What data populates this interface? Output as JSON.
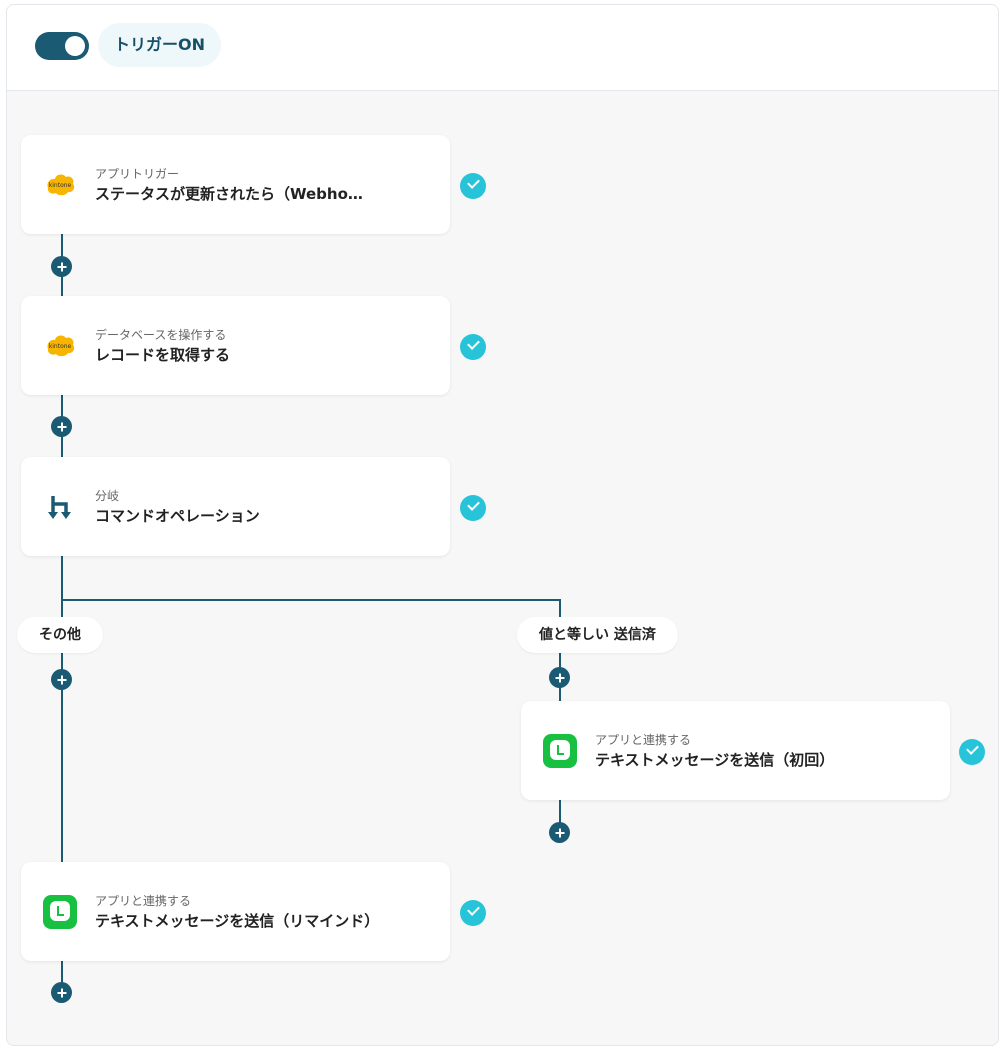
{
  "header": {
    "trigger_label": "トリガーON"
  },
  "icons": {
    "kintone_text": "kintone"
  },
  "flow": {
    "steps": [
      {
        "sub": "アプリトリガー",
        "main": "ステータスが更新されたら（Webho…",
        "icon": "kintone-icon"
      },
      {
        "sub": "データベースを操作する",
        "main": "レコードを取得する",
        "icon": "kintone-icon"
      },
      {
        "sub": "分岐",
        "main": "コマンドオペレーション",
        "icon": "branch-icon"
      },
      {
        "sub": "アプリと連携する",
        "main": "テキストメッセージを送信（初回）",
        "icon": "line-icon"
      },
      {
        "sub": "アプリと連携する",
        "main": "テキストメッセージを送信（リマインド）",
        "icon": "line-icon"
      }
    ],
    "branches": {
      "left_label": "その他",
      "right_label": "値と等しい 送信済"
    }
  },
  "colors": {
    "accent": "#1a5a73",
    "check": "#27c3d8",
    "line_green": "#18c042",
    "kintone_yellow": "#f7b500"
  }
}
